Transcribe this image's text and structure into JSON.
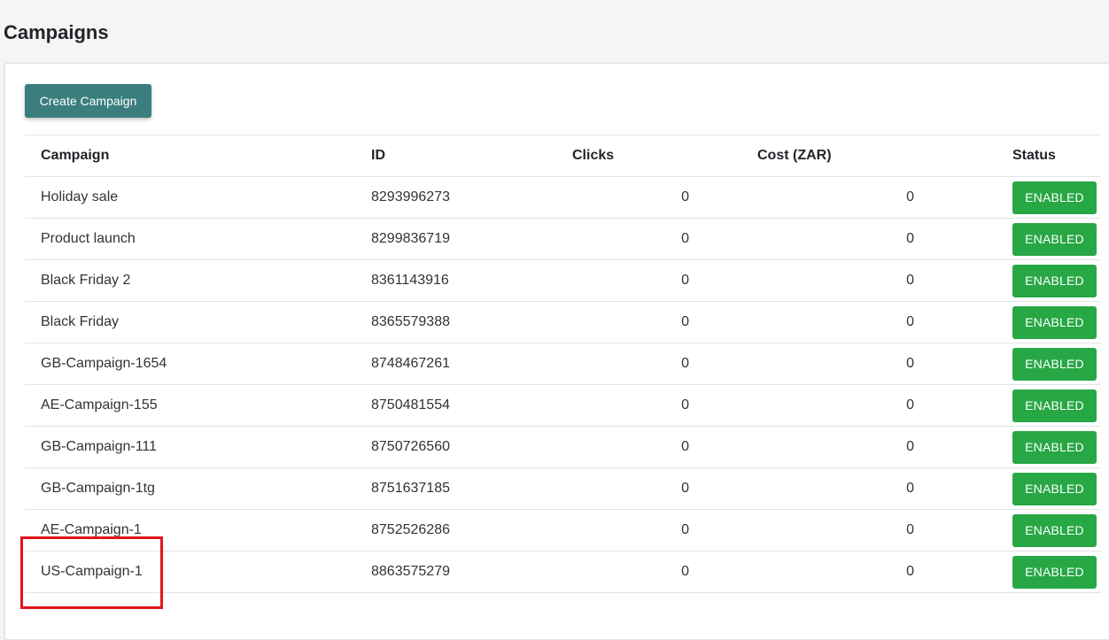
{
  "page": {
    "title": "Campaigns"
  },
  "toolbar": {
    "create_label": "Create Campaign"
  },
  "table": {
    "headers": {
      "campaign": "Campaign",
      "id": "ID",
      "clicks": "Clicks",
      "cost": "Cost (ZAR)",
      "status": "Status"
    },
    "rows": [
      {
        "campaign": "Holiday sale",
        "id": "8293996273",
        "clicks": "0",
        "cost": "0",
        "status": "ENABLED"
      },
      {
        "campaign": "Product launch",
        "id": "8299836719",
        "clicks": "0",
        "cost": "0",
        "status": "ENABLED"
      },
      {
        "campaign": "Black Friday 2",
        "id": "8361143916",
        "clicks": "0",
        "cost": "0",
        "status": "ENABLED"
      },
      {
        "campaign": "Black Friday",
        "id": "8365579388",
        "clicks": "0",
        "cost": "0",
        "status": "ENABLED"
      },
      {
        "campaign": "GB-Campaign-1654",
        "id": "8748467261",
        "clicks": "0",
        "cost": "0",
        "status": "ENABLED"
      },
      {
        "campaign": "AE-Campaign-155",
        "id": "8750481554",
        "clicks": "0",
        "cost": "0",
        "status": "ENABLED"
      },
      {
        "campaign": "GB-Campaign-111",
        "id": "8750726560",
        "clicks": "0",
        "cost": "0",
        "status": "ENABLED"
      },
      {
        "campaign": "GB-Campaign-1tg",
        "id": "8751637185",
        "clicks": "0",
        "cost": "0",
        "status": "ENABLED"
      },
      {
        "campaign": "AE-Campaign-1",
        "id": "8752526286",
        "clicks": "0",
        "cost": "0",
        "status": "ENABLED"
      },
      {
        "campaign": "US-Campaign-1",
        "id": "8863575279",
        "clicks": "0",
        "cost": "0",
        "status": "ENABLED"
      }
    ]
  },
  "colors": {
    "primary_button": "#3a7f7d",
    "status_enabled": "#28a745",
    "highlight": "#e0161b"
  }
}
